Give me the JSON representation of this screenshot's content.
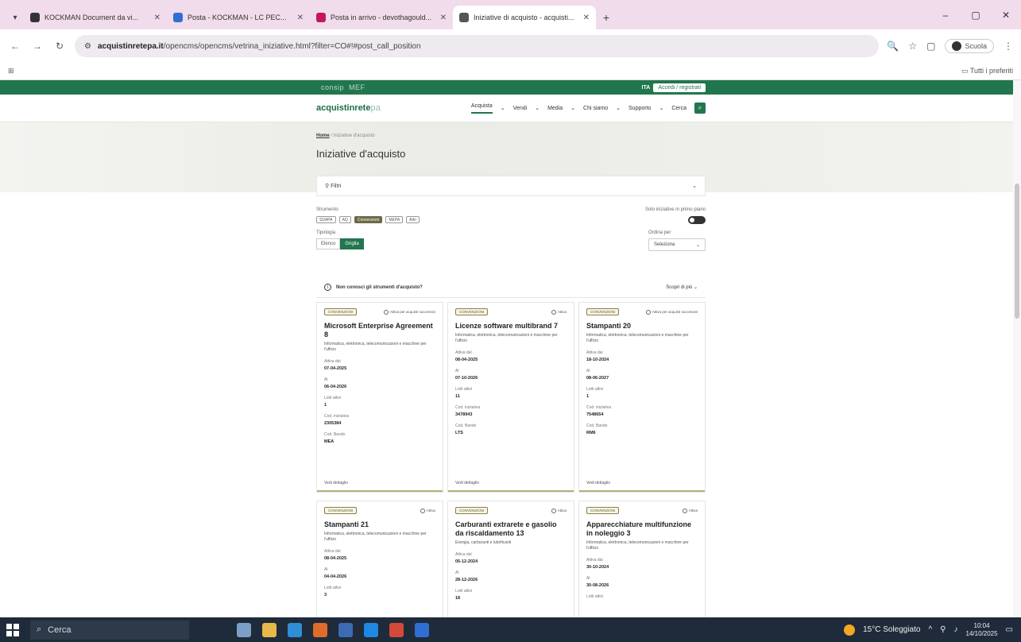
{
  "browser": {
    "tabs": [
      {
        "title": "KOCKMAN Document da vi...",
        "color": "#333"
      },
      {
        "title": "Posta - KOCKMAN - LC PEC...",
        "color": "#2f6fd1"
      },
      {
        "title": "Posta in arrivo - devothagould...",
        "color": "#c2185b"
      },
      {
        "title": "Iniziative di acquisto - acquisti...",
        "color": "#555"
      }
    ],
    "new_tab": "+",
    "window_controls": [
      "–",
      "▢",
      "✕"
    ],
    "url_host": "acquistinretepa.it",
    "url_path": "/opencms/opencms/vetrina_iniziative.html?filter=CO#!#post_call_position",
    "profile_label": "Scuola",
    "bookmarks_right": "Tutti i preferiti"
  },
  "site": {
    "brand": "consip",
    "brand_sub": "MEF",
    "lang": "ITA",
    "register_label": "Accedi / registrati",
    "logo_main": "acquistinrete",
    "logo_suffix": "pa",
    "menu": [
      "Acquista",
      "Vendi",
      "Media",
      "Chi siamo",
      "Supporto"
    ],
    "search_label": "Cerca",
    "breadcrumb_home": "Home",
    "breadcrumb_current": "Iniziative d'acquisto",
    "page_title": "Iniziative d'acquisto",
    "filter_label": "Filtri",
    "strumento_label": "Strumento",
    "chips": [
      "SDAPA",
      "AQ",
      "Convenzioni",
      "MEPA",
      "Altri"
    ],
    "active_chip": 2,
    "toggle_label": "Solo iniziative in primo piano",
    "tipologia_label": "Tipologia",
    "segments": [
      "Elenco",
      "Griglia"
    ],
    "order_label": "Ordina per",
    "order_value": "Seleziona",
    "info_text": "Non conosci gli strumenti d'acquisto?",
    "info_link": "Scopri di più"
  },
  "cards": [
    {
      "badge": "CONVENZIONI",
      "action": "Attiva per acquisti successivi",
      "title": "Microsoft Enterprise Agreement 8",
      "desc": "Informatica, elettronica, telecomunicazioni e macchine per l'ufficio",
      "fields": [
        [
          "Attiva dal",
          "07-04-2025"
        ],
        [
          "Al",
          "06-04-2026"
        ],
        [
          "Lotti attivi",
          "1"
        ],
        [
          "Cod. iniziativa",
          "2305384"
        ],
        [
          "Cod. Bando",
          "MEA"
        ]
      ],
      "foot": "Vedi dettaglio"
    },
    {
      "badge": "CONVENZIONI",
      "action": "Attiva",
      "title": "Licenze software multibrand 7",
      "desc": "Informatica, elettronica, telecomunicazioni e macchine per l'ufficio",
      "fields": [
        [
          "Attiva dal",
          "08-04-2025"
        ],
        [
          "Al",
          "07-10-2026"
        ],
        [
          "Lotti attivi",
          "11"
        ],
        [
          "Cod. iniziativa",
          "3478943"
        ],
        [
          "Cod. Bando",
          "LTS"
        ]
      ],
      "foot": "Vedi dettaglio"
    },
    {
      "badge": "CONVENZIONI",
      "action": "Attiva per acquisti successivi",
      "title": "Stampanti 20",
      "desc": "Informatica, elettronica, telecomunicazioni e macchine per l'ufficio",
      "fields": [
        [
          "Attiva dal",
          "18-10-2024"
        ],
        [
          "Al",
          "08-06-2027"
        ],
        [
          "Lotti attivi",
          "1"
        ],
        [
          "Cod. iniziativa",
          "7548654"
        ],
        [
          "Cod. Bando",
          "RM6"
        ]
      ],
      "foot": "Vedi dettaglio"
    },
    {
      "badge": "CONVENZIONI",
      "action": "Attiva",
      "title": "Stampanti 21",
      "desc": "Informatica, elettronica, telecomunicazioni e macchine per l'ufficio",
      "fields": [
        [
          "Attiva dal",
          "08-04-2025"
        ],
        [
          "Al",
          "04-04-2026"
        ],
        [
          "Lotti attivi",
          "3"
        ]
      ],
      "foot": ""
    },
    {
      "badge": "CONVENZIONI",
      "action": "Attiva",
      "title": "Carburanti extrarete e gasolio da riscaldamento 13",
      "desc": "Energia, carburanti e lubrificanti",
      "fields": [
        [
          "Attiva dal",
          "05-12-2024"
        ],
        [
          "Al",
          "28-12-2026"
        ],
        [
          "Lotti attivi",
          "18"
        ]
      ],
      "foot": ""
    },
    {
      "badge": "CONVENZIONI",
      "action": "Attiva",
      "title": "Apparecchiature multifunzione in noleggio 3",
      "desc": "Informatica, elettronica, telecomunicazioni e macchine per l'ufficio",
      "fields": [
        [
          "Attiva dal",
          "30-10-2024"
        ],
        [
          "Al",
          "30-08-2026"
        ],
        [
          "Lotti attivi",
          ""
        ]
      ],
      "foot": ""
    }
  ],
  "taskbar": {
    "search_placeholder": "Cerca",
    "weather": "15°C Soleggiato",
    "time": "10:04",
    "date": "14/10/2025",
    "app_colors": [
      "#7aa0c8",
      "#e8b84a",
      "#2f8fd6",
      "#e06b2a",
      "#3d6bb3",
      "#1e88e5",
      "#d44a3a",
      "#2f6fd1"
    ]
  }
}
